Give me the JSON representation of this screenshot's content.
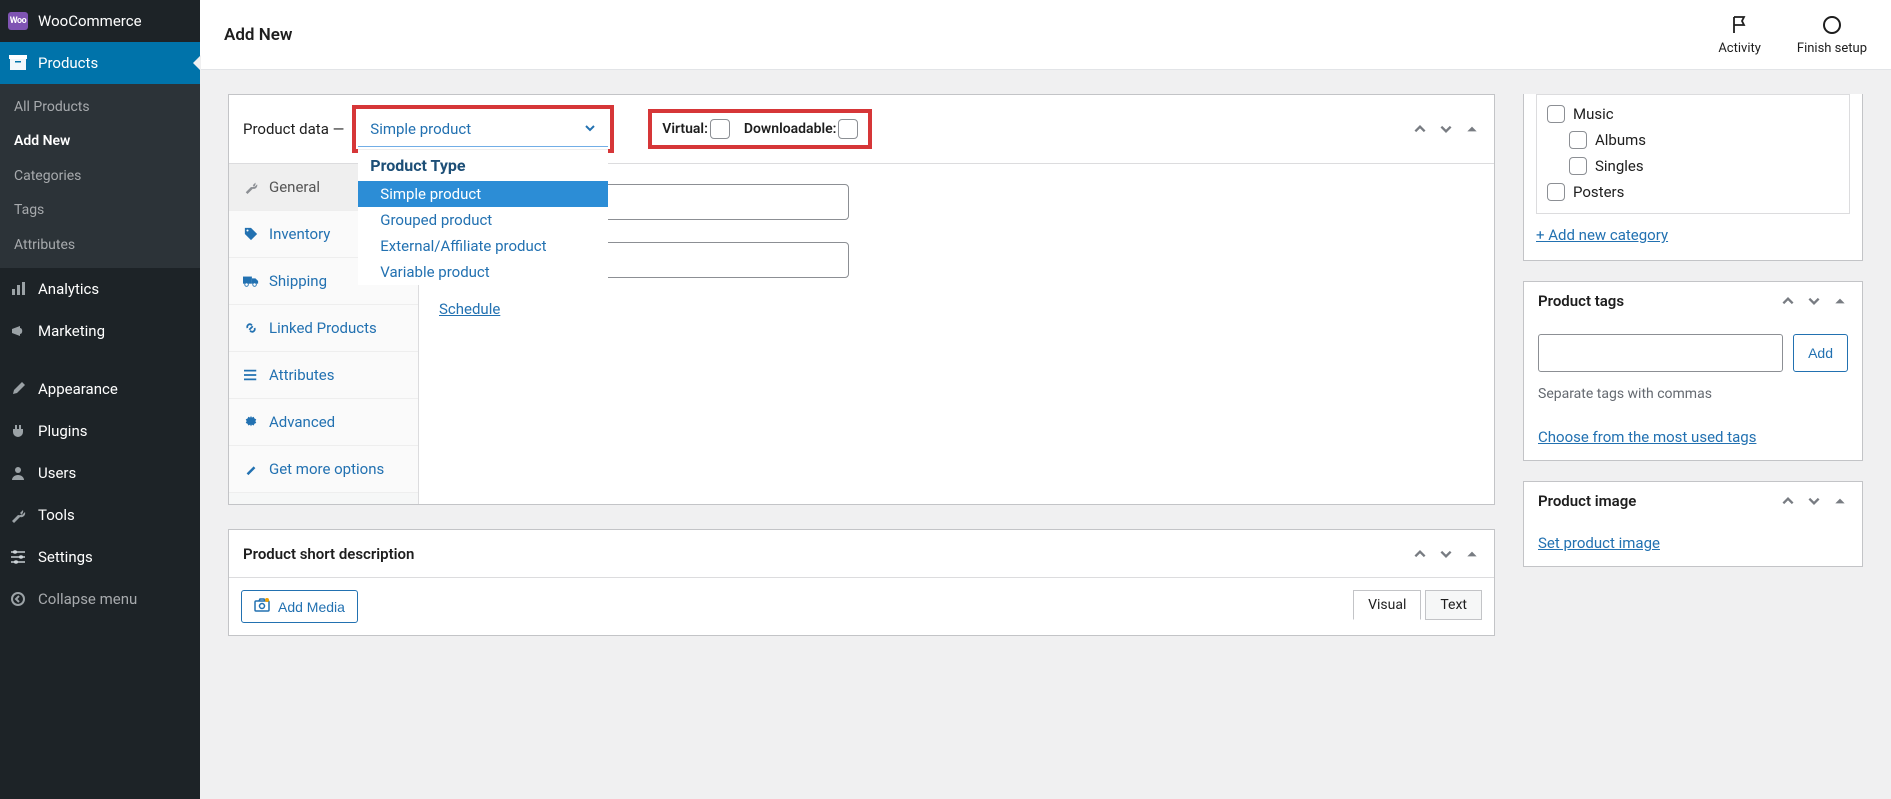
{
  "sidebar": {
    "woocommerce": "WooCommerce",
    "products": "Products",
    "submenu": [
      {
        "label": "All Products",
        "active": false
      },
      {
        "label": "Add New",
        "active": true
      },
      {
        "label": "Categories",
        "active": false
      },
      {
        "label": "Tags",
        "active": false
      },
      {
        "label": "Attributes",
        "active": false
      }
    ],
    "analytics": "Analytics",
    "marketing": "Marketing",
    "appearance": "Appearance",
    "plugins": "Plugins",
    "users": "Users",
    "tools": "Tools",
    "settings": "Settings",
    "collapse": "Collapse menu"
  },
  "topbar": {
    "title": "Add New",
    "activity": "Activity",
    "finish_setup": "Finish setup"
  },
  "product_data": {
    "label": "Product data —",
    "selected": "Simple product",
    "dropdown_header": "Product Type",
    "options": [
      {
        "label": "Simple product",
        "selected": true
      },
      {
        "label": "Grouped product",
        "selected": false
      },
      {
        "label": "External/Affiliate product",
        "selected": false
      },
      {
        "label": "Variable product",
        "selected": false
      }
    ],
    "virtual_label": "Virtual:",
    "downloadable_label": "Downloadable:",
    "tabs": [
      {
        "label": "General",
        "icon": "wrench",
        "active": true
      },
      {
        "label": "Inventory",
        "icon": "tag",
        "active": false
      },
      {
        "label": "Shipping",
        "icon": "truck",
        "active": false
      },
      {
        "label": "Linked Products",
        "icon": "link",
        "active": false
      },
      {
        "label": "Attributes",
        "icon": "list",
        "active": false
      },
      {
        "label": "Advanced",
        "icon": "gear",
        "active": false
      },
      {
        "label": "Get more options",
        "icon": "wand",
        "active": false
      }
    ],
    "schedule": "Schedule"
  },
  "short_desc": {
    "title": "Product short description",
    "add_media": "Add Media",
    "visual": "Visual",
    "text": "Text"
  },
  "categories": {
    "items": [
      {
        "label": "Music",
        "indent": false
      },
      {
        "label": "Albums",
        "indent": true
      },
      {
        "label": "Singles",
        "indent": true
      },
      {
        "label": "Posters",
        "indent": false
      }
    ],
    "add_new": "+ Add new category"
  },
  "tags": {
    "title": "Product tags",
    "add": "Add",
    "hint": "Separate tags with commas",
    "choose": "Choose from the most used tags"
  },
  "image": {
    "title": "Product image",
    "set": "Set product image"
  }
}
